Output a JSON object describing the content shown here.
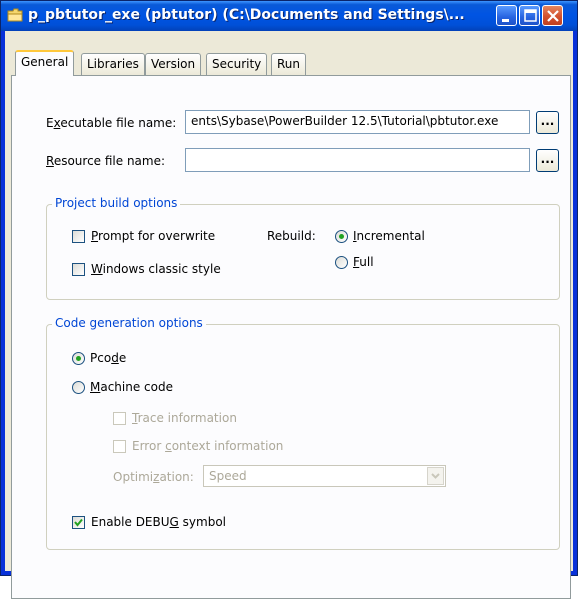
{
  "window": {
    "title": "p_pbtutor_exe (pbtutor) (C:\\Documents and Settings\\..."
  },
  "tabs": [
    {
      "label": "General",
      "active": true
    },
    {
      "label": "Libraries",
      "active": false
    },
    {
      "label": "Version",
      "active": false
    },
    {
      "label": "Security",
      "active": false
    },
    {
      "label": "Run",
      "active": false
    }
  ],
  "general": {
    "exe_label_pre": "E",
    "exe_label_ul": "x",
    "exe_label_post": "ecutable file name:",
    "exe_value": "ents\\Sybase\\PowerBuilder 12.5\\Tutorial\\pbtutor.exe",
    "res_label_ul": "R",
    "res_label_post": "esource file name:",
    "res_value": "",
    "browse_label": "..."
  },
  "project_build": {
    "legend": "Project build options",
    "prompt_ul": "P",
    "prompt_rest": "rompt for overwrite",
    "prompt_checked": false,
    "classic_ul": "W",
    "classic_rest": "indows classic style",
    "classic_checked": false,
    "rebuild_label": "Rebuild:",
    "incremental_ul": "I",
    "incremental_rest": "ncremental",
    "full_ul": "F",
    "full_rest": "ull",
    "rebuild_selected": "Incremental"
  },
  "code_gen": {
    "legend": "Code generation options",
    "pcode_pre": "Pco",
    "pcode_ul": "d",
    "pcode_post": "e",
    "machine_ul": "M",
    "machine_rest": "achine code",
    "selected": "Pcode",
    "trace_ul": "T",
    "trace_rest": "race information",
    "error_pre": "Error ",
    "error_ul": "c",
    "error_post": "ontext information",
    "opt_pre": "Optimi",
    "opt_ul": "z",
    "opt_post": "ation:",
    "opt_value": "Speed",
    "debug_pre": "Enable DEBU",
    "debug_ul": "G",
    "debug_post": " symbol",
    "debug_checked": true
  },
  "colors": {
    "titlebar": "#0054e3",
    "accent_green": "#21a121",
    "group_legend": "#0046d5"
  }
}
